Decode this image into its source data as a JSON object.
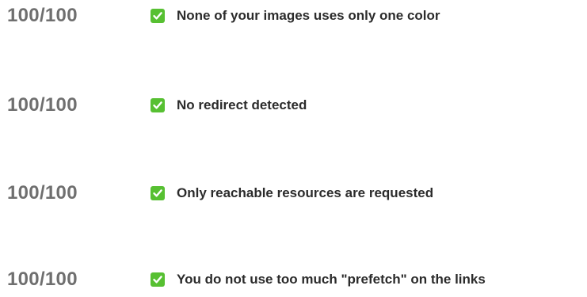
{
  "rules": [
    {
      "score": "100/100",
      "status_icon": "check-icon",
      "text": "None of your images uses only one color"
    },
    {
      "score": "100/100",
      "status_icon": "check-icon",
      "text": "No redirect detected"
    },
    {
      "score": "100/100",
      "status_icon": "check-icon",
      "text": "Only reachable resources are requested"
    },
    {
      "score": "100/100",
      "status_icon": "check-icon",
      "text": "You do not use too much \"prefetch\" on the links"
    }
  ],
  "colors": {
    "score_text": "#6f6f6f",
    "check_bg": "#57c032",
    "rule_text": "#2b2b2b"
  }
}
